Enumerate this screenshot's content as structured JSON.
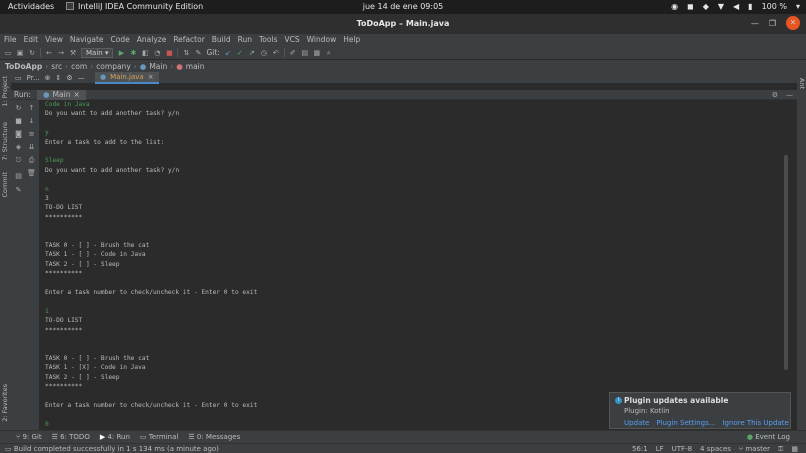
{
  "gnome": {
    "activities": "Actividades",
    "app_name": "IntelliJ IDEA Community Edition",
    "clock": "jue 14 de ene  09:05",
    "battery": "100 %"
  },
  "window": {
    "title": "ToDoApp – Main.java"
  },
  "menu": [
    "File",
    "Edit",
    "View",
    "Navigate",
    "Code",
    "Analyze",
    "Refactor",
    "Build",
    "Run",
    "Tools",
    "VCS",
    "Window",
    "Help"
  ],
  "toolbar": {
    "run_config": "Main",
    "git_label": "Git:"
  },
  "breadcrumb": {
    "project": "ToDoApp",
    "parts": [
      "src",
      "com",
      "company"
    ],
    "class": "Main",
    "method": "main"
  },
  "editor": {
    "project_tab": "Pr...",
    "file_tab": "Main.java"
  },
  "left_stripe": {
    "project": "1: Project",
    "structure": "7: Structure",
    "commit": "Commit",
    "favorites": "2: Favorites"
  },
  "right_stripe": {
    "ant": "Ant"
  },
  "run_panel": {
    "label": "Run:",
    "tab": "Main"
  },
  "console": {
    "lines": [
      {
        "text": "Code in Java",
        "input": true
      },
      {
        "text": "Do you want to add another task? y/n",
        "input": false
      },
      {
        "text": "",
        "input": false
      },
      {
        "text": "y",
        "input": true
      },
      {
        "text": "Enter a task to add to the list:",
        "input": false
      },
      {
        "text": "",
        "input": false
      },
      {
        "text": "Sleep",
        "input": true
      },
      {
        "text": "Do you want to add another task? y/n",
        "input": false
      },
      {
        "text": "",
        "input": false
      },
      {
        "text": "n",
        "input": true
      },
      {
        "text": "3",
        "input": false
      },
      {
        "text": "TO-DO LIST",
        "input": false
      },
      {
        "text": "**********",
        "input": false
      },
      {
        "text": "",
        "input": false
      },
      {
        "text": "",
        "input": false
      },
      {
        "text": "TASK 0 - [ ] - Brush the cat",
        "input": false
      },
      {
        "text": "TASK 1 - [ ] - Code in Java",
        "input": false
      },
      {
        "text": "TASK 2 - [ ] - Sleep",
        "input": false
      },
      {
        "text": "**********",
        "input": false
      },
      {
        "text": "",
        "input": false
      },
      {
        "text": "Enter a task number to check/uncheck it - Enter 0 to exit",
        "input": false
      },
      {
        "text": "",
        "input": false
      },
      {
        "text": "1",
        "input": true
      },
      {
        "text": "TO-DO LIST",
        "input": false
      },
      {
        "text": "**********",
        "input": false
      },
      {
        "text": "",
        "input": false
      },
      {
        "text": "",
        "input": false
      },
      {
        "text": "TASK 0 - [ ] - Brush the cat",
        "input": false
      },
      {
        "text": "TASK 1 - [X] - Code in Java",
        "input": false
      },
      {
        "text": "TASK 2 - [ ] - Sleep",
        "input": false
      },
      {
        "text": "**********",
        "input": false
      },
      {
        "text": "",
        "input": false
      },
      {
        "text": "Enter a task number to check/uncheck it - Enter 0 to exit",
        "input": false
      },
      {
        "text": "",
        "input": false
      },
      {
        "text": "0",
        "input": true
      }
    ]
  },
  "notification": {
    "title": "Plugin updates available",
    "subtitle": "Plugin: Kotlin",
    "actions": [
      "Update",
      "Plugin Settings...",
      "Ignore This Update"
    ]
  },
  "tool_windows": [
    "9: Git",
    "6: TODO",
    "4: Run",
    "Terminal",
    "0: Messages"
  ],
  "event_log": "Event Log",
  "status": {
    "message": "Build completed successfully in 1 s 134 ms (a minute ago)",
    "position": "56:1",
    "line_sep": "LF",
    "encoding": "UTF-8",
    "indent": "4 spaces",
    "branch": "master"
  },
  "colors": {
    "accent": "#4a88c7",
    "close_button": "#e95420",
    "input_text": "#499c54",
    "link": "#589df6"
  }
}
